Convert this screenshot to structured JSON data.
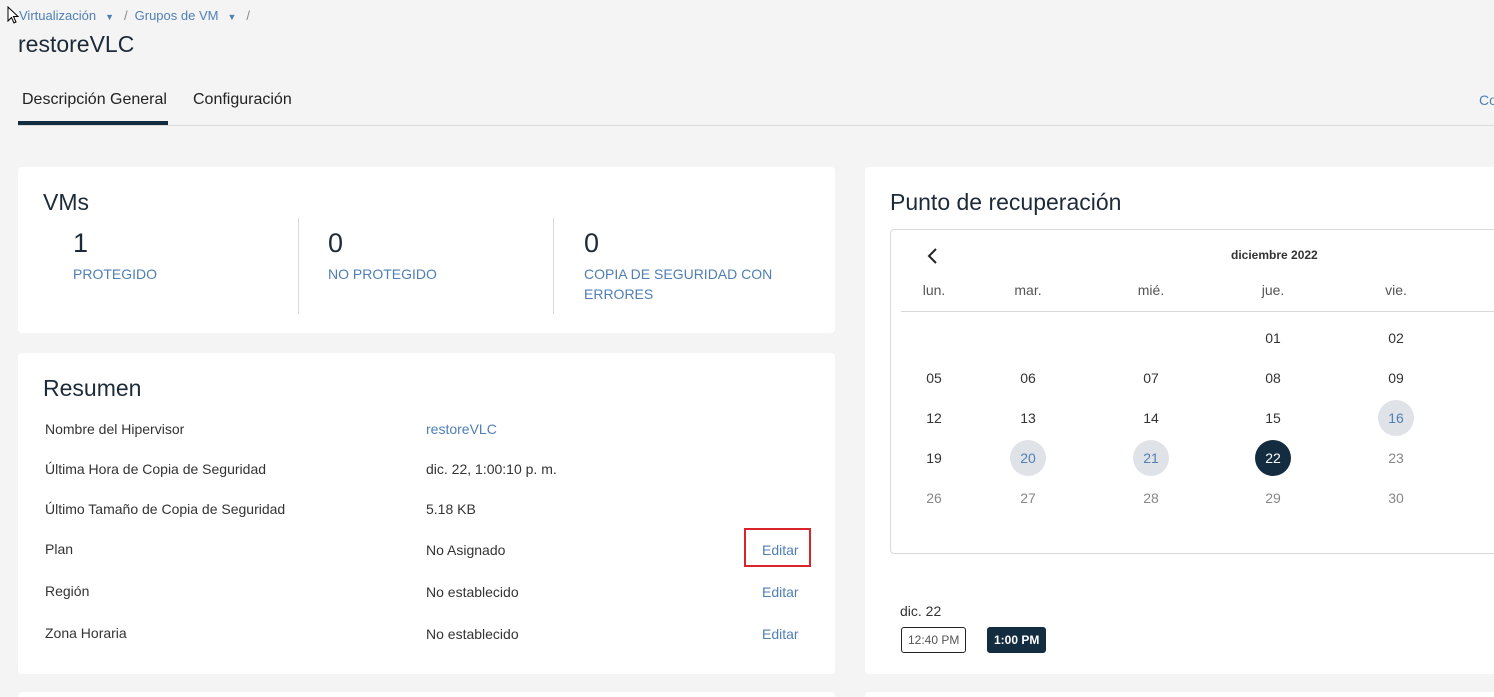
{
  "breadcrumb": {
    "level1": "Virtualización",
    "level2": "Grupos de VM",
    "separator": "/"
  },
  "page_title": "restoreVLC",
  "tabs": {
    "overview": "Descripción General",
    "config": "Configuración",
    "right_link": "Co"
  },
  "vms": {
    "title": "VMs",
    "stats": [
      {
        "value": "1",
        "label": "PROTEGIDO"
      },
      {
        "value": "0",
        "label": "NO PROTEGIDO"
      },
      {
        "value": "0",
        "label": "COPIA DE SEGURIDAD CON ERRORES"
      }
    ]
  },
  "summary": {
    "title": "Resumen",
    "edit_label": "Editar",
    "rows": [
      {
        "label": "Nombre del Hipervisor",
        "value": "restoreVLC"
      },
      {
        "label": "Última Hora de Copia de Seguridad",
        "value": "dic. 22, 1:00:10 p. m."
      },
      {
        "label": "Último Tamaño de Copia de Seguridad",
        "value": "5.18 KB"
      },
      {
        "label": "Plan",
        "value": "No Asignado"
      },
      {
        "label": "Región",
        "value": "No establecido"
      },
      {
        "label": "Zona Horaria",
        "value": "No establecido"
      }
    ]
  },
  "recovery": {
    "title": "Punto de recuperación",
    "month": "diciembre 2022",
    "weekdays": [
      "lun.",
      "mar.",
      "mié.",
      "jue.",
      "vie."
    ],
    "weeks": [
      [
        "",
        "",
        "",
        "01",
        "02"
      ],
      [
        "05",
        "06",
        "07",
        "08",
        "09"
      ],
      [
        "12",
        "13",
        "14",
        "15",
        "16"
      ],
      [
        "19",
        "20",
        "21",
        "22",
        "23"
      ],
      [
        "26",
        "27",
        "28",
        "29",
        "30"
      ]
    ],
    "selected_date": "dic. 22",
    "times": [
      "12:40 PM",
      "1:00 PM"
    ]
  },
  "colors": {
    "accent_dark": "#142c3f",
    "link_blue": "#4f7fb5",
    "highlight_red": "#d9242a"
  }
}
